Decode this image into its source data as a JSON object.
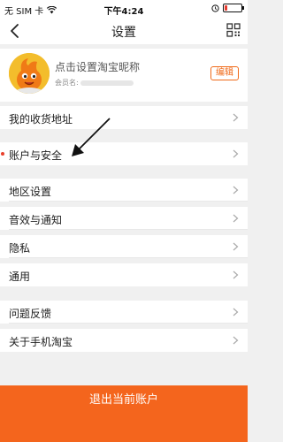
{
  "status_bar": {
    "carrier": "无 SIM 卡",
    "time": "下午4:24",
    "battery_level": 0.15
  },
  "nav": {
    "title": "设置"
  },
  "profile": {
    "nickname_prompt": "点击设置淘宝昵称",
    "member_label": "会员名:",
    "edit_label": "编辑"
  },
  "settings": {
    "items": [
      {
        "label": "我的收货地址"
      },
      {
        "label": "账户与安全"
      },
      {
        "label": "地区设置"
      },
      {
        "label": "音效与通知"
      },
      {
        "label": "隐私"
      },
      {
        "label": "通用"
      },
      {
        "label": "问题反馈"
      },
      {
        "label": "关于手机淘宝"
      }
    ]
  },
  "logout_label": "退出当前账户",
  "colors": {
    "accent": "#f4651d",
    "edit": "#f06a19",
    "alert_dot": "#e8402c"
  }
}
